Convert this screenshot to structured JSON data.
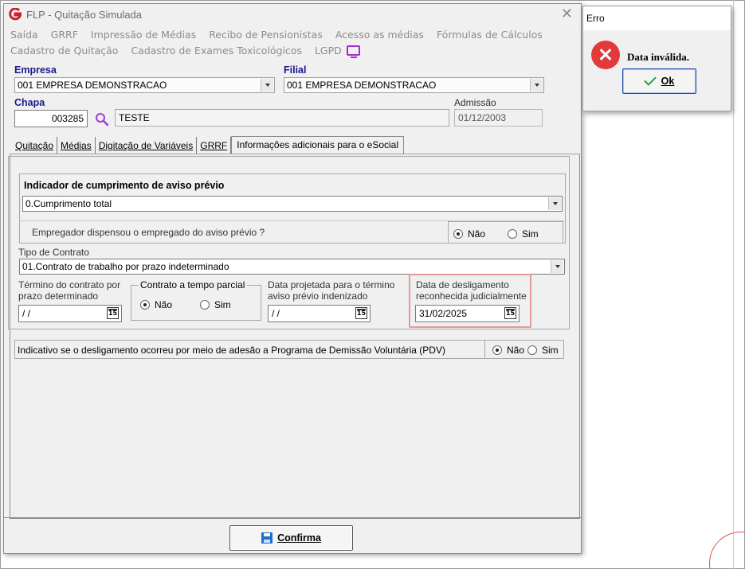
{
  "window": {
    "title": "FLP - Quitação Simulada",
    "close_glyph": "✕"
  },
  "menu": {
    "row1": [
      "Saída",
      "GRRF",
      "Impressão de Médias",
      "Recibo de Pensionistas",
      "Acesso as médias",
      "Fórmulas de Cálculos"
    ],
    "row2": [
      "Cadastro de Quitação",
      "Cadastro de Exames Toxicológicos",
      "LGPD"
    ]
  },
  "form": {
    "empresa_label": "Empresa",
    "empresa_value": "001 EMPRESA DEMONSTRACAO",
    "filial_label": "Filial",
    "filial_value": "001 EMPRESA DEMONSTRACAO",
    "chapa_label": "Chapa",
    "chapa_value": "003285",
    "nome_value": "TESTE",
    "admissao_label": "Admissão",
    "admissao_value": "01/12/2003"
  },
  "tabs": [
    "Quitação",
    "Médias",
    "Digitação de Variáveis",
    "GRRF",
    "Informações adicionais para o eSocial"
  ],
  "esocial": {
    "aviso_title": "Indicador de cumprimento de aviso prévio",
    "aviso_value": "0.Cumprimento total",
    "dispensou_label": "Empregador dispensou o empregado do aviso prévio ?",
    "opt_nao": "Não",
    "opt_sim": "Sim",
    "tipo_contrato_label": "Tipo de Contrato",
    "tipo_contrato_value": "01.Contrato de trabalho por prazo indeterminado",
    "termino_label": "Término do contrato por prazo determinado",
    "termino_value": " /  /",
    "parcial_label": "Contrato a tempo parcial",
    "projetada_label": "Data projetada para o término aviso prévio indenizado",
    "projetada_value": " /  /",
    "deslig_label": "Data de desligamento reconhecida judicialmente",
    "deslig_value": "31/02/2025",
    "pdv_label": "Indicativo se o desligamento ocorreu por meio de adesão a Programa de Demissão Voluntária (PDV)",
    "cal_glyph": "15"
  },
  "confirm_button": "Confirma",
  "error_dialog": {
    "title": "Erro",
    "message": "Data inválida.",
    "ok_label": "Ok"
  }
}
